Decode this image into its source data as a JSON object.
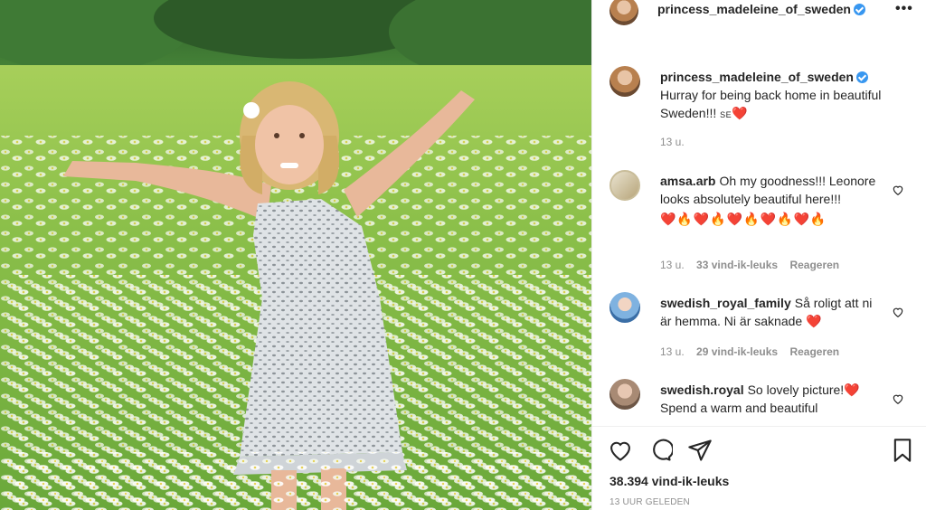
{
  "post": {
    "username": "princess_madeleine_of_sweden",
    "more_label": "•••",
    "caption": "Hurray for being back home in beautiful Sweden!!! ",
    "caption_flag": "SE",
    "caption_heart": "❤️",
    "caption_time": "13 u.",
    "likes": "38.394 vind-ik-leuks",
    "time_ago": "13 UUR GELEDEN"
  },
  "comments": [
    {
      "username": "amsa.arb",
      "text": "Oh my goodness!!! Leonore looks absolutely beautiful here!!!",
      "emoji": "❤️🔥❤️🔥❤️🔥❤️🔥❤️🔥",
      "time": "13 u.",
      "likes": "33 vind-ik-leuks",
      "reply": "Reageren"
    },
    {
      "username": "swedish_royal_family",
      "text": "Så roligt att ni är hemma. Ni är saknade ❤️",
      "time": "13 u.",
      "likes": "29 vind-ik-leuks",
      "reply": "Reageren"
    },
    {
      "username": "swedish.royal",
      "text": "So lovely picture!❤️ Spend a warm and beautiful"
    }
  ],
  "icons": {
    "like": "heart-outline-icon",
    "comment": "speech-bubble-icon",
    "share": "paper-plane-icon",
    "save": "bookmark-icon",
    "verified": "verified-badge-icon"
  },
  "colors": {
    "verified": "#3897f0",
    "secondary_text": "#8e8e8e",
    "primary_text": "#262626",
    "divider": "#efefef"
  }
}
